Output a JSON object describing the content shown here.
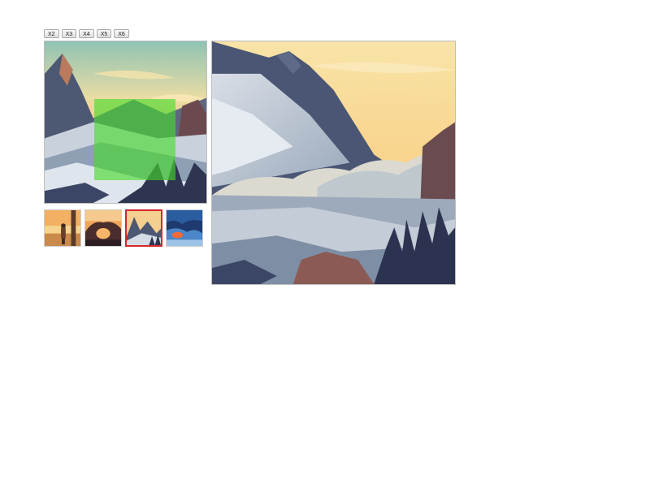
{
  "zoom": {
    "buttons": [
      {
        "label": "X2"
      },
      {
        "label": "X3"
      },
      {
        "label": "X4"
      },
      {
        "label": "X5"
      },
      {
        "label": "X6"
      }
    ]
  },
  "gallery": {
    "selected_index": 2,
    "thumbnails": [
      {
        "subject": "woman-by-lake"
      },
      {
        "subject": "rock-arch-sunset"
      },
      {
        "subject": "snowy-mountains"
      },
      {
        "subject": "glowing-cave"
      }
    ]
  },
  "colors": {
    "lens": "#46dc28",
    "active_thumb_border": "#d7262c"
  }
}
